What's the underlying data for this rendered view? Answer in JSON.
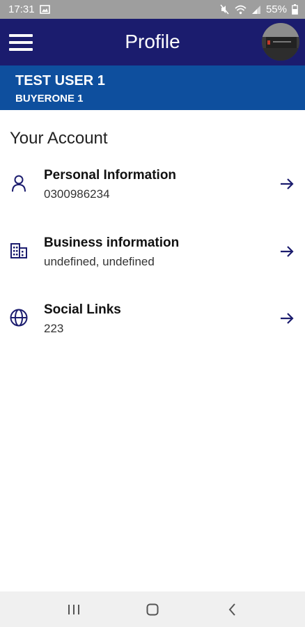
{
  "status_bar": {
    "time": "17:31",
    "battery": "55%",
    "icons": [
      "gallery-notification-icon",
      "mute-icon",
      "wifi-icon",
      "signal-icon",
      "battery-icon"
    ]
  },
  "app_bar": {
    "title": "Profile",
    "menu_icon": "hamburger-menu-icon"
  },
  "user": {
    "name": "TEST USER 1",
    "subtitle": "BUYERONE 1"
  },
  "section": {
    "title": "Your Account"
  },
  "items": [
    {
      "title": "Personal Information",
      "subtitle": "0300986234",
      "icon": "person-icon"
    },
    {
      "title": "Business information",
      "subtitle": "undefined, undefined",
      "icon": "building-icon"
    },
    {
      "title": "Social Links",
      "subtitle": "223",
      "icon": "globe-icon"
    }
  ],
  "colors": {
    "app_bar": "#1b1c6e",
    "user_bar": "#0e4f9e",
    "status_bar": "#9e9e9e",
    "nav_bar": "#f0f0f0",
    "icon": "#1b1c6e"
  },
  "nav_bar": {
    "buttons": [
      "recent-apps-icon",
      "home-icon",
      "back-icon"
    ]
  }
}
